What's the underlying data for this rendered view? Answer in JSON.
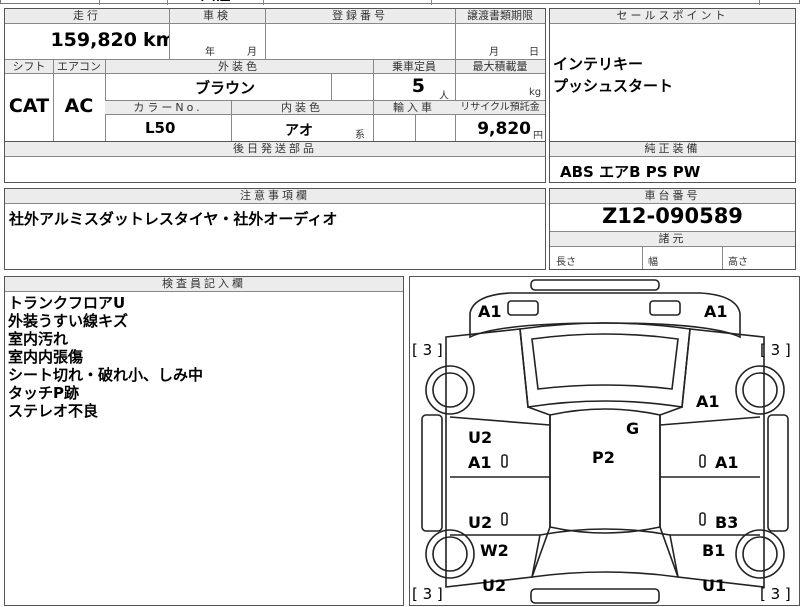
{
  "top_partial": {
    "value": "西暦"
  },
  "vehicle": {
    "mileage_label": "走行",
    "mileage": "159,820",
    "mileage_unit": "km",
    "shaken_label": "車検",
    "shaken_year_unit": "年",
    "shaken_month_unit": "月",
    "reg_label": "登録番号",
    "transfer_label": "譲渡書類期限",
    "transfer_month_unit": "月",
    "transfer_day_unit": "日",
    "shift_label": "シフト",
    "shift": "CAT",
    "ac_label": "エアコン",
    "ac": "AC",
    "color_label": "外装色",
    "color": "ブラウン",
    "capacity_label": "乗車定員",
    "capacity": "5",
    "capacity_unit": "人",
    "maxload_label": "最大積載量",
    "maxload_unit": "kg",
    "colorno_label": "カラーNo.",
    "colorno": "L50",
    "interior_label": "内装色",
    "interior": "アオ",
    "interior_suffix": "系",
    "import_label": "輸入車",
    "recycle_label": "リサイクル預託金",
    "recycle": "9,820",
    "recycle_unit": "円",
    "later_label": "後日発送部品"
  },
  "sales": {
    "label": "セールスポイント",
    "points": [
      "インテリキー",
      "プッシュスタート"
    ]
  },
  "equipment": {
    "label": "純正装備",
    "value": "ABS エアB PS PW"
  },
  "notes": {
    "label": "注意事項欄",
    "value": "社外アルミスダットレスタイヤ・社外オーディオ"
  },
  "chassis": {
    "label": "車台番号",
    "value": "Z12-090589"
  },
  "dims": {
    "label": "諸元",
    "length": "長さ",
    "width": "幅",
    "height": "高さ"
  },
  "inspector": {
    "label": "検査員記入欄",
    "lines": [
      "トランクフロアU",
      "外装うすい線キズ",
      "室内汚れ",
      "室内内張傷",
      "シート切れ・破れ小、しみ中",
      "タッチP跡",
      "ステレオ不良"
    ]
  },
  "diagram": {
    "marks": {
      "rear_left": "A1",
      "rear_right": "A1",
      "rear_left_tire": "[ 3 ]",
      "rear_right_tire": "[ 3 ]",
      "front_left_tire": "[ 3 ]",
      "front_right_tire": "[ 3 ]",
      "roof_right": "A1",
      "glass": "G",
      "roof": "P2",
      "left_rear_door_top": "U2",
      "left_rear_door": "A1",
      "right_rear_door": "A1",
      "left_front_door": "U2",
      "right_front_door": "B3",
      "left_front_fender": "W2",
      "right_front_fender": "B1",
      "left_front": "U2",
      "right_front": "U1"
    }
  }
}
